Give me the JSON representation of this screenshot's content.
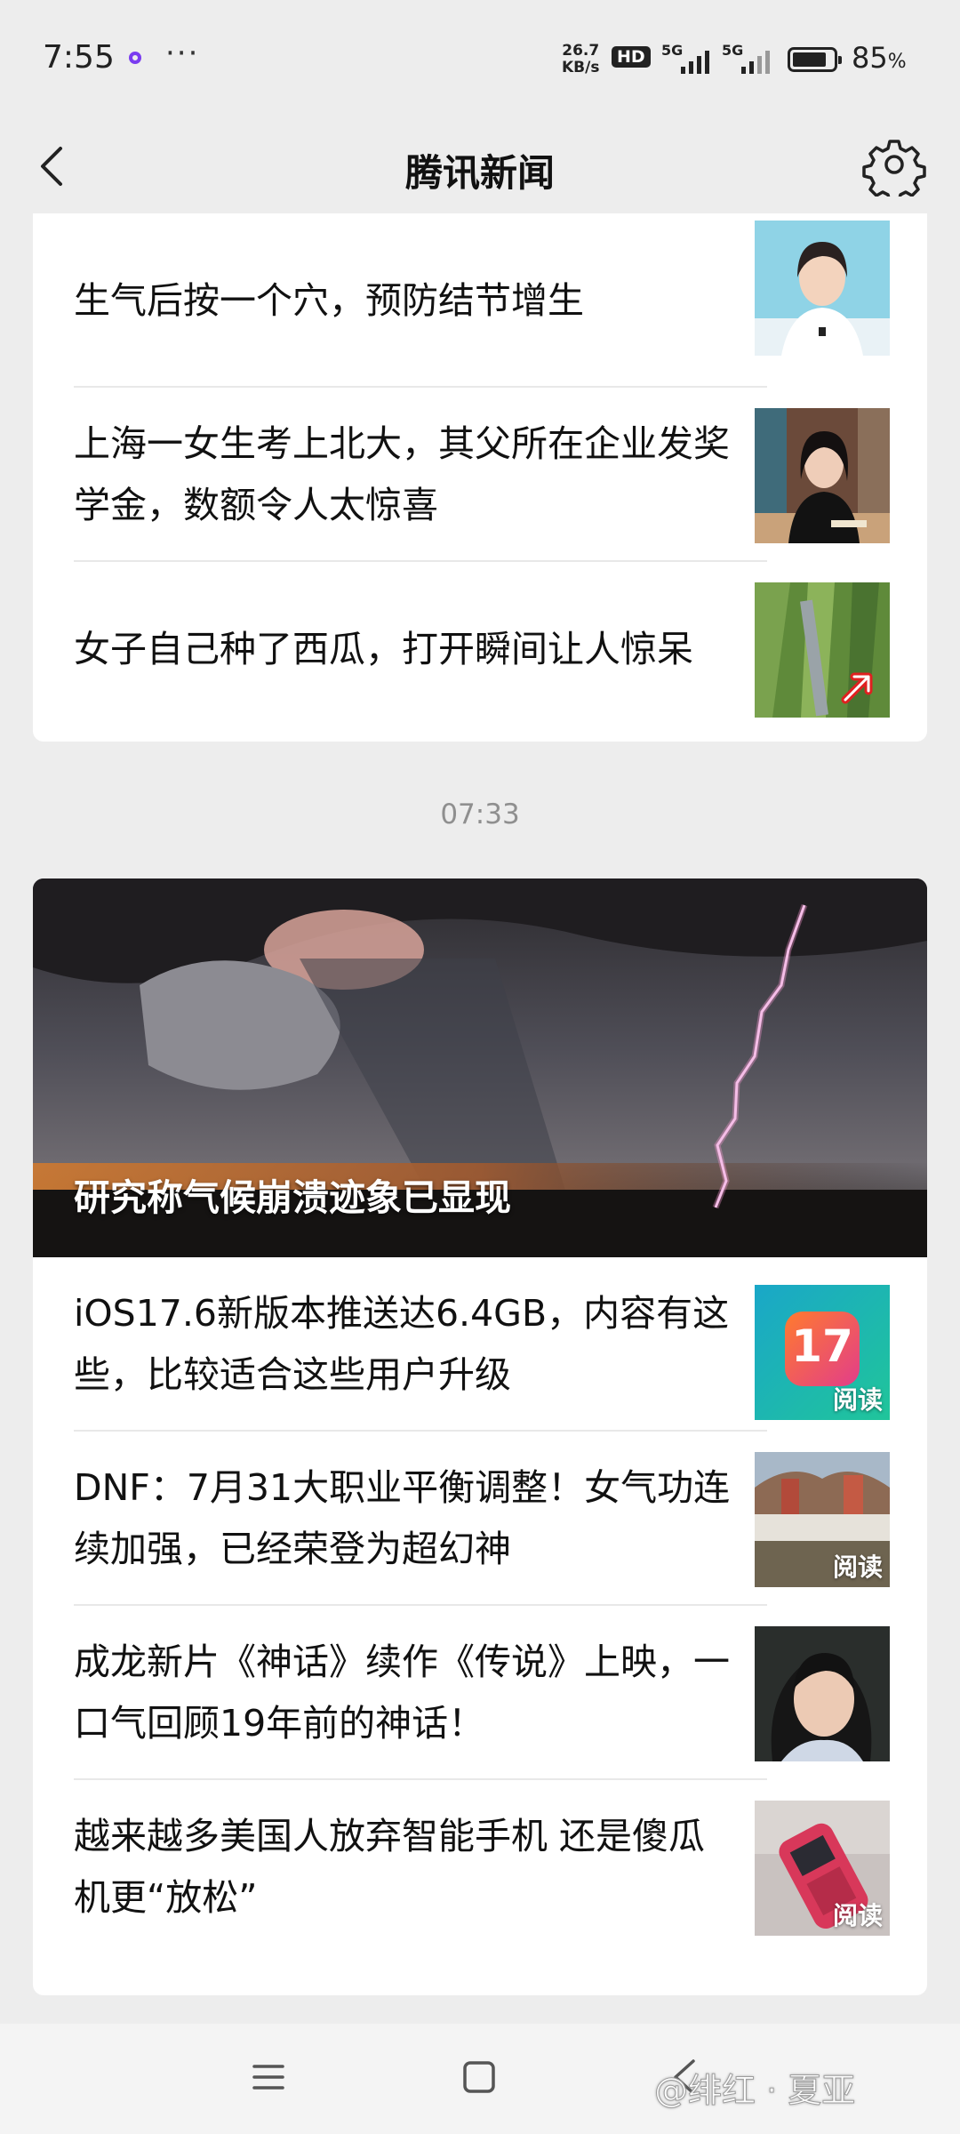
{
  "status_bar": {
    "time": "7:55",
    "net_speed_value": "26.7",
    "net_speed_unit": "KB/s",
    "hd_label": "HD",
    "sim1_label": "5G",
    "sim2_label": "5G",
    "battery_percent": 85,
    "battery_text": "85",
    "battery_unit": "%"
  },
  "header": {
    "title": "腾讯新闻"
  },
  "top_card": {
    "items": [
      {
        "title": "生气后按一个穴，预防结节增生"
      },
      {
        "title": "上海一女生考上北大，其父所在企业发奖学金，数额令人太惊喜"
      },
      {
        "title": "女子自己种了西瓜，打开瞬间让人惊呆"
      }
    ]
  },
  "time_label": "07:33",
  "bottom_card": {
    "hero_title": "研究称气候崩溃迹象已显现",
    "items": [
      {
        "title": "iOS17.6新版本推送达6.4GB，内容有这些，比较适合这些用户升级",
        "thumb_text": "17",
        "badge": "阅读"
      },
      {
        "title": "DNF：7月31大职业平衡调整！女气功连续加强，已经荣登为超幻神",
        "badge": "阅读"
      },
      {
        "title": "成龙新片《神话》续作《传说》上映，一口气回顾19年前的神话！"
      },
      {
        "title": "越来越多美国人放弃智能手机 还是傻瓜机更“放松”",
        "badge": "阅读"
      }
    ]
  },
  "watermark": "@绯红 · 夏亚",
  "colors": {
    "background": "#ededed",
    "card": "#ffffff",
    "accent_dot": "#7a3cf0"
  }
}
